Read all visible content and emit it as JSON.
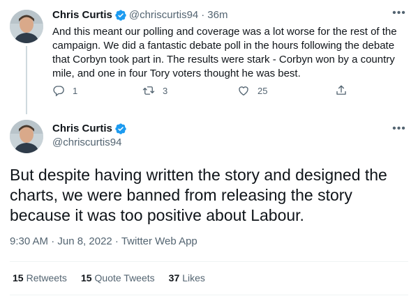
{
  "colors": {
    "verified_blue": "#1d9bf0",
    "text_primary": "#0f1419",
    "text_secondary": "#536471"
  },
  "reply_tweet": {
    "author_name": "Chris Curtis",
    "handle": "@chriscurtis94",
    "separator": "·",
    "time": "36m",
    "more_icon": "more-horizontal-icon",
    "text": "And this meant our polling and coverage was a lot worse for the rest of the campaign. We did a fantastic debate poll in the hours following the debate that Corbyn took part in. The results were stark - Corbyn won by a country mile, and one in four Tory voters thought he was best.",
    "actions": {
      "reply_icon": "reply-icon",
      "reply_count": "1",
      "retweet_icon": "retweet-icon",
      "retweet_count": "3",
      "like_icon": "heart-icon",
      "like_count": "25",
      "share_icon": "share-icon"
    }
  },
  "main_tweet": {
    "author_name": "Chris Curtis",
    "handle": "@chriscurtis94",
    "more_icon": "more-horizontal-icon",
    "text": "But despite having written the story and designed the charts, we were banned from releasing the story because it was too positive about Labour.",
    "meta": "9:30 AM · Jun 8, 2022 · Twitter Web App",
    "stats": {
      "retweets_count": "15",
      "retweets_label": "Retweets",
      "quotes_count": "15",
      "quotes_label": "Quote Tweets",
      "likes_count": "37",
      "likes_label": "Likes"
    }
  }
}
